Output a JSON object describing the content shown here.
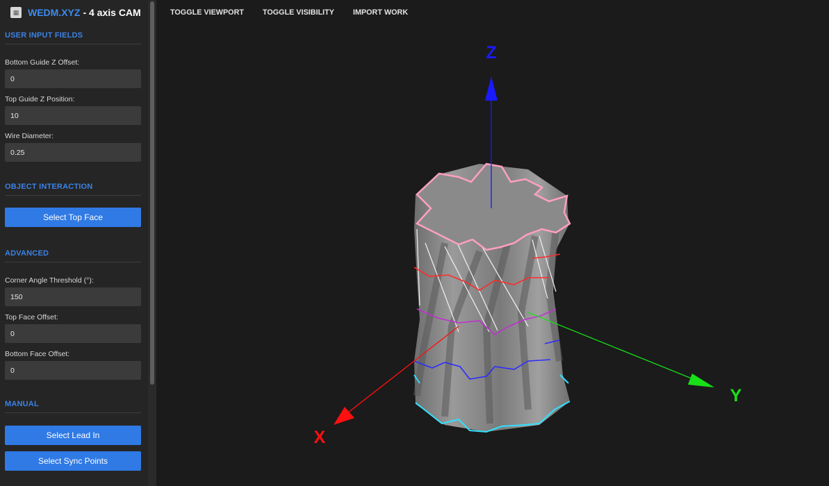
{
  "app": {
    "name": "WEDM.XYZ",
    "subtitle": "- 4 axis CAM",
    "logo_icon": "app-logo-icon"
  },
  "toolbar": {
    "items": [
      "TOGGLE VIEWPORT",
      "TOGGLE VISIBILITY",
      "IMPORT WORK"
    ]
  },
  "sections": {
    "user_input": {
      "title": "USER INPUT FIELDS",
      "fields": [
        {
          "label": "Bottom Guide Z Offset:",
          "value": "0"
        },
        {
          "label": "Top Guide Z Position:",
          "value": "10"
        },
        {
          "label": "Wire Diameter:",
          "value": "0.25"
        }
      ]
    },
    "object_interaction": {
      "title": "OBJECT INTERACTION",
      "button": "Select Top Face"
    },
    "advanced": {
      "title": "ADVANCED",
      "fields": [
        {
          "label": "Corner Angle Threshold (°):",
          "value": "150"
        },
        {
          "label": "Top Face Offset:",
          "value": "0"
        },
        {
          "label": "Bottom Face Offset:",
          "value": "0"
        }
      ]
    },
    "manual": {
      "title": "MANUAL",
      "buttons": [
        "Select Lead In",
        "Select Sync Points"
      ]
    }
  },
  "viewport": {
    "axes": {
      "x": "X",
      "y": "Y",
      "z": "Z"
    },
    "colors": {
      "x": "#ff1010",
      "y": "#18e018",
      "z": "#1a1aff",
      "background": "#1b1b1b",
      "model": "#8c8c8c"
    }
  }
}
